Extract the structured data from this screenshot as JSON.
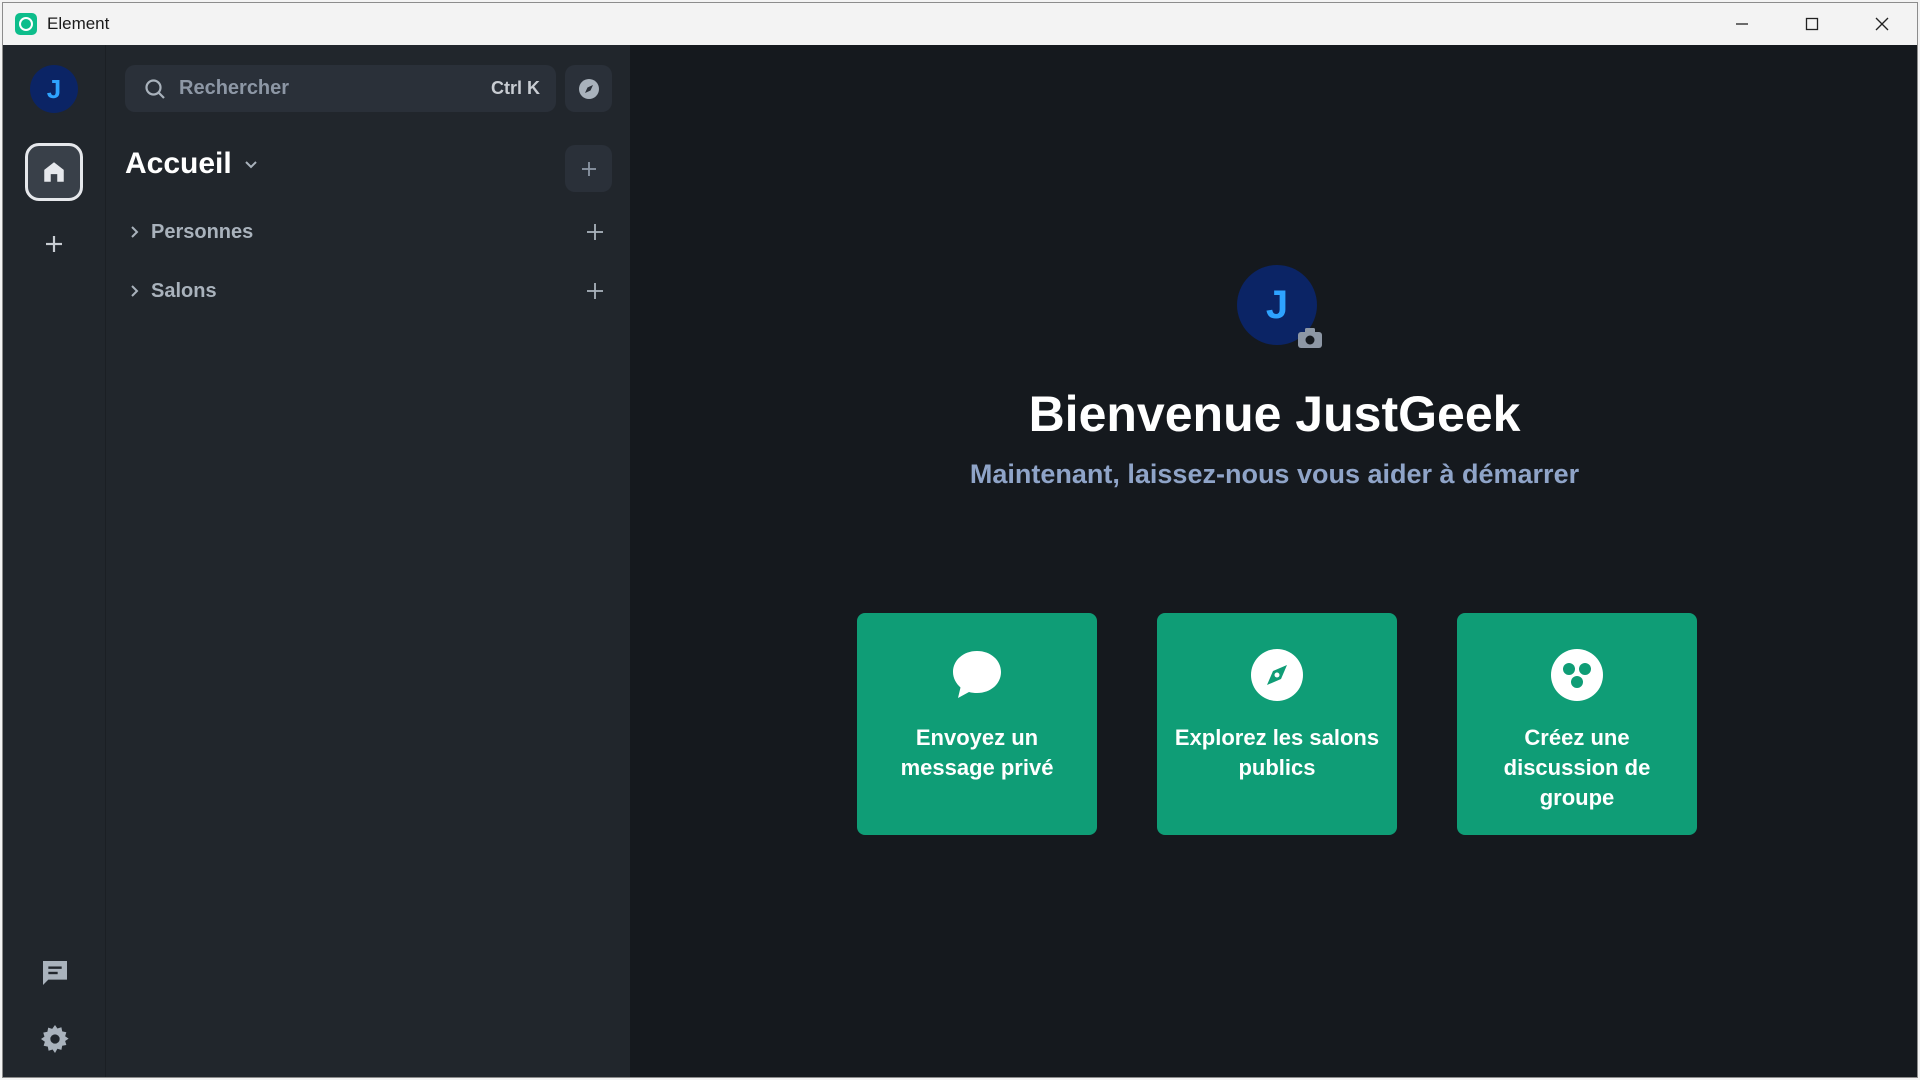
{
  "window": {
    "title": "Element",
    "minimize_icon": "minimize-icon",
    "maximize_icon": "maximize-icon",
    "close_icon": "close-icon"
  },
  "spacebar": {
    "avatar_initial": "J",
    "home_icon": "home-icon",
    "add_icon": "plus-icon",
    "threads_icon": "threads-icon",
    "settings_icon": "gear-icon"
  },
  "roomlist": {
    "search": {
      "placeholder": "Rechercher",
      "shortcut": "Ctrl K"
    },
    "home_title": "Accueil",
    "sections": [
      {
        "label": "Personnes"
      },
      {
        "label": "Salons"
      }
    ]
  },
  "main": {
    "avatar_initial": "J",
    "welcome_title": "Bienvenue JustGeek",
    "welcome_subtitle": "Maintenant, laissez-nous vous aider à démarrer",
    "cards": [
      {
        "label": "Envoyez un message privé",
        "icon": "chat-bubble-icon"
      },
      {
        "label": "Explorez les salons publics",
        "icon": "compass-icon"
      },
      {
        "label": "Créez une discussion de groupe",
        "icon": "group-icon"
      }
    ]
  },
  "colors": {
    "accent": "#0dbd8b",
    "card": "#0f9d76",
    "avatar_bg": "#0b2465",
    "avatar_text": "#2ea3ff",
    "sidebar": "#21262c",
    "main_bg": "#15191e"
  }
}
